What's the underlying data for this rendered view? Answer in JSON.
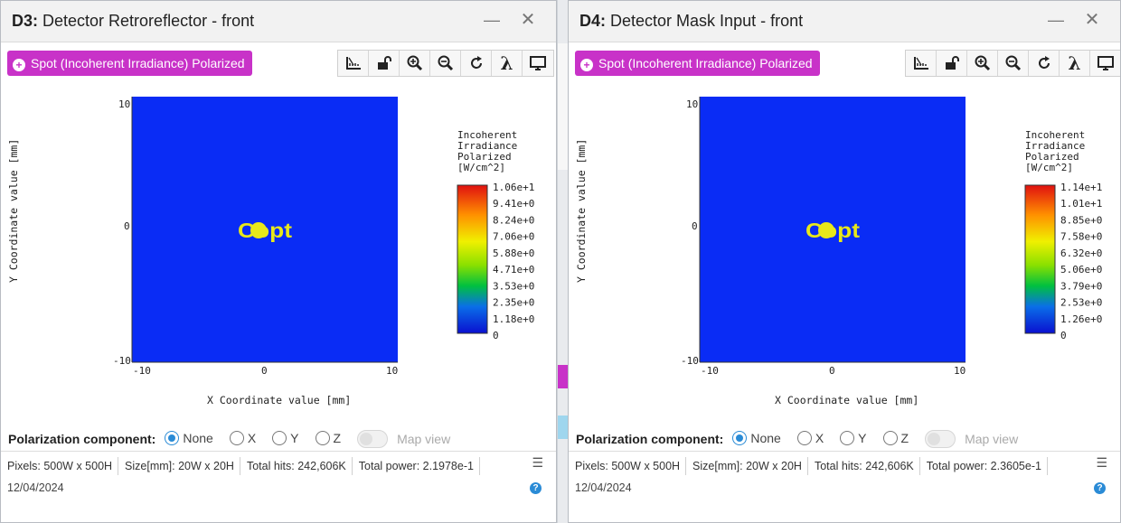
{
  "windows": [
    {
      "id": "d3",
      "title_id": "D3:",
      "title_rest": " Detector Retroreflector - front",
      "minimize_glyph": "—",
      "close_glyph": "✕",
      "spot_label": "Spot (Incoherent Irradiance) Polarized",
      "toolbar": [
        "ruler-icon",
        "unlock-icon",
        "zoom-in-icon",
        "zoom-out-icon",
        "refresh-icon",
        "lambda-icon",
        "monitor-icon"
      ],
      "lambda_glyph": "λ",
      "plot": {
        "ylabel": "Y Coordinate value [mm]",
        "xlabel": "X Coordinate value [mm]",
        "x_ticks": [
          "-10",
          "0",
          "10"
        ],
        "y_ticks": [
          "10",
          "0",
          "-10"
        ],
        "spot_text": "Copt",
        "legend_title": [
          "Incoherent",
          "Irradiance",
          "Polarized",
          "[W/cm^2]"
        ],
        "legend_ticks": [
          "1.06e+1",
          "9.41e+0",
          "8.24e+0",
          "7.06e+0",
          "5.88e+0",
          "4.71e+0",
          "3.53e+0",
          "2.35e+0",
          "1.18e+0",
          "0"
        ]
      },
      "polarization": {
        "label": "Polarization component:",
        "options": [
          "None",
          "X",
          "Y",
          "Z"
        ],
        "selected": "None",
        "map_view": "Map view"
      },
      "status": {
        "pixels_label": "Pixels:",
        "pixels": "500W x 500H",
        "size_label": "Size[mm]:",
        "size": "20W x 20H",
        "hits_label": "Total hits:",
        "hits": "242,606K",
        "power_label": "Total power:",
        "power": "2.1978e-1"
      },
      "date": "12/04/2024"
    },
    {
      "id": "d4",
      "title_id": "D4:",
      "title_rest": " Detector Mask Input - front",
      "minimize_glyph": "—",
      "close_glyph": "✕",
      "spot_label": "Spot (Incoherent Irradiance) Polarized",
      "toolbar": [
        "ruler-icon",
        "unlock-icon",
        "zoom-in-icon",
        "zoom-out-icon",
        "refresh-icon",
        "lambda-icon",
        "monitor-icon"
      ],
      "lambda_glyph": "λ",
      "plot": {
        "ylabel": "Y Coordinate value [mm]",
        "xlabel": "X Coordinate value [mm]",
        "x_ticks": [
          "-10",
          "0",
          "10"
        ],
        "y_ticks": [
          "10",
          "0",
          "-10"
        ],
        "spot_text": "Copt",
        "legend_title": [
          "Incoherent",
          "Irradiance",
          "Polarized",
          "[W/cm^2]"
        ],
        "legend_ticks": [
          "1.14e+1",
          "1.01e+1",
          "8.85e+0",
          "7.58e+0",
          "6.32e+0",
          "5.06e+0",
          "3.79e+0",
          "2.53e+0",
          "1.26e+0",
          "0"
        ]
      },
      "polarization": {
        "label": "Polarization component:",
        "options": [
          "None",
          "X",
          "Y",
          "Z"
        ],
        "selected": "None",
        "map_view": "Map view"
      },
      "status": {
        "pixels_label": "Pixels:",
        "pixels": "500W x 500H",
        "size_label": "Size[mm]:",
        "size": "20W x 20H",
        "hits_label": "Total hits:",
        "hits": "242,606K",
        "power_label": "Total power:",
        "power": "2.3605e-1"
      },
      "date": "12/04/2024"
    }
  ],
  "colors": {
    "plot_fill": "#0a2cf5",
    "spot": "#e8e81a",
    "accent": "#c832c8",
    "selected_radio": "#2a8bd6"
  }
}
